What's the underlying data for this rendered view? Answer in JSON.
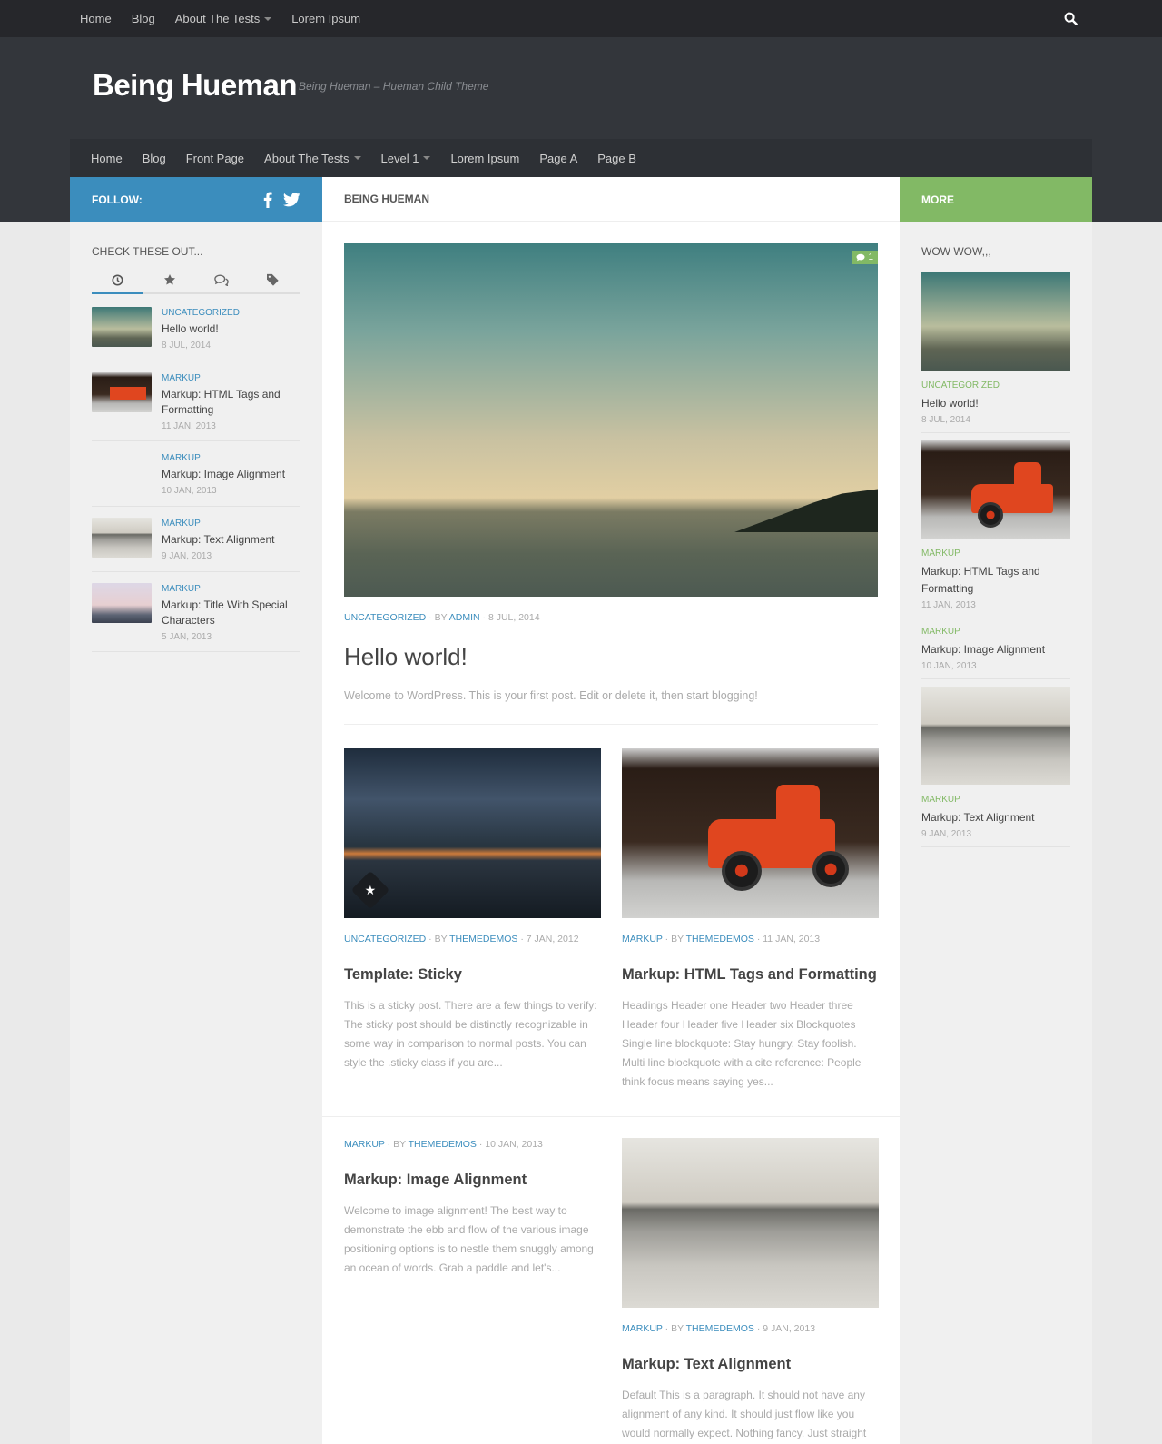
{
  "topnav": {
    "items": [
      {
        "label": "Home"
      },
      {
        "label": "Blog"
      },
      {
        "label": "About The Tests"
      },
      {
        "label": "Lorem Ipsum"
      }
    ]
  },
  "header": {
    "title": "Being Hueman",
    "description": "Being Hueman – Hueman Child Theme"
  },
  "mainnav": {
    "items": [
      {
        "label": "Home"
      },
      {
        "label": "Blog"
      },
      {
        "label": "Front Page"
      },
      {
        "label": "About The Tests"
      },
      {
        "label": "Level 1"
      },
      {
        "label": "Lorem Ipsum"
      },
      {
        "label": "Page A"
      },
      {
        "label": "Page B"
      }
    ]
  },
  "sidebar_left": {
    "follow_label": "FOLLOW:",
    "widget_title": "CHECK THESE OUT...",
    "posts": [
      {
        "category": "UNCATEGORIZED",
        "title": "Hello world!",
        "date": "8 JUL, 2014"
      },
      {
        "category": "MARKUP",
        "title": "Markup: HTML Tags and Formatting",
        "date": "11 JAN, 2013"
      },
      {
        "category": "MARKUP",
        "title": "Markup: Image Alignment",
        "date": "10 JAN, 2013"
      },
      {
        "category": "MARKUP",
        "title": "Markup: Text Alignment",
        "date": "9 JAN, 2013"
      },
      {
        "category": "MARKUP",
        "title": "Markup: Title With Special Characters",
        "date": "5 JAN, 2013"
      }
    ]
  },
  "content": {
    "heading": "BEING HUEMAN",
    "featured": {
      "comments": "1",
      "category": "UNCATEGORIZED",
      "by": "BY",
      "author": "ADMIN",
      "date": "8 JUL, 2014",
      "title": "Hello world!",
      "excerpt": "Welcome to WordPress. This is your first post. Edit or delete it, then start blogging!"
    },
    "posts": [
      {
        "category": "UNCATEGORIZED",
        "by": "BY",
        "author": "THEMEDEMOS",
        "date": "7 JAN, 2012",
        "title": "Template: Sticky",
        "excerpt": "This is a sticky post. There are a few things to verify: The sticky post should be distinctly recognizable in some way in comparison to normal posts. You can style the .sticky class if you are..."
      },
      {
        "category": "MARKUP",
        "by": "BY",
        "author": "THEMEDEMOS",
        "date": "11 JAN, 2013",
        "title": "Markup: HTML Tags and Formatting",
        "excerpt": "Headings Header one Header two Header three Header four Header five Header six Blockquotes Single line blockquote: Stay hungry. Stay foolish. Multi line blockquote with a cite reference: People think focus means saying yes..."
      },
      {
        "category": "MARKUP",
        "by": "BY",
        "author": "THEMEDEMOS",
        "date": "10 JAN, 2013",
        "title": "Markup: Image Alignment",
        "excerpt": "Welcome to image alignment! The best way to demonstrate the ebb and flow of the various image positioning options is to nestle them snuggly among an ocean of words. Grab a paddle and let's..."
      },
      {
        "category": "MARKUP",
        "by": "BY",
        "author": "THEMEDEMOS",
        "date": "9 JAN, 2013",
        "title": "Markup: Text Alignment",
        "excerpt": "Default This is a paragraph. It should not have any alignment of any kind. It should just flow like you would normally expect. Nothing fancy. Just straight"
      }
    ]
  },
  "sidebar_right": {
    "more_label": "MORE",
    "widget_title": "WOW WOW,,,",
    "posts": [
      {
        "category": "UNCATEGORIZED",
        "title": "Hello world!",
        "date": "8 JUL, 2014"
      },
      {
        "category": "MARKUP",
        "title": "Markup: HTML Tags and Formatting",
        "date": "11 JAN, 2013"
      },
      {
        "category": "MARKUP",
        "title": "Markup: Image Alignment",
        "date": "10 JAN, 2013"
      },
      {
        "category": "MARKUP",
        "title": "Markup: Text Alignment",
        "date": "9 JAN, 2013"
      }
    ]
  },
  "colors": {
    "accent_blue": "#3b8dbd",
    "accent_green": "#82b965",
    "header_bg": "#33363b",
    "topbar_bg": "#26272b"
  },
  "icons": [
    "search-icon",
    "facebook-icon",
    "twitter-icon",
    "clock-icon",
    "star-icon",
    "comments-icon",
    "tags-icon",
    "comment-bubble-icon",
    "sticky-star-icon"
  ]
}
